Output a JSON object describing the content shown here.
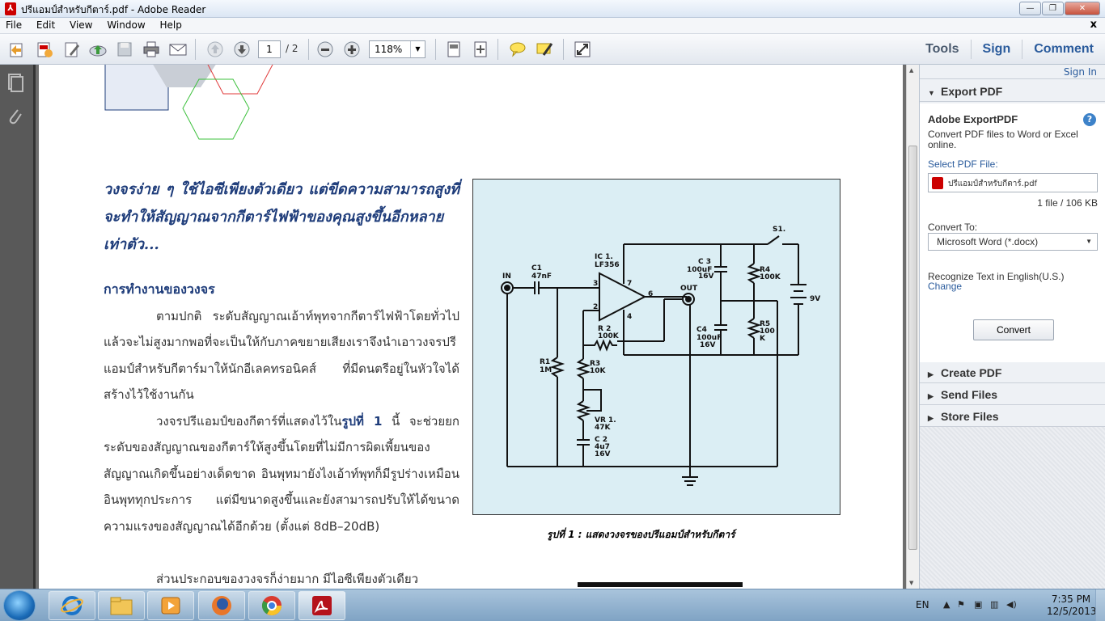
{
  "window": {
    "title": "ปรีแอมป์สำหรับกีตาร์.pdf - Adobe Reader",
    "minimize": "—",
    "maximize": "❐",
    "close": "✕"
  },
  "menu": {
    "items": [
      "File",
      "Edit",
      "View",
      "Window",
      "Help"
    ],
    "doc_close": "x"
  },
  "toolbar": {
    "page_current": "1",
    "page_total": "/ 2",
    "zoom": "118%",
    "tools_label": "Tools",
    "sign_label": "Sign",
    "comment_label": "Comment"
  },
  "document": {
    "headline": "วงจรง่าย ๆ ใช้ไอซีเพียงตัวเดียว แต่ขีดความสามารถสูงที่จะทำให้สัญญาณจากกีตาร์ไฟฟ้าของคุณสูงขึ้นอีกหลายเท่าตัว...",
    "section_title": "การทำงานของวงจร",
    "para1": "ตามปกติ ระดับสัญญาณเอ้าท์พุทจากกีตาร์ไฟฟ้าโดยทั่วไปแล้วจะไม่สูงมากพอที่จะเป็นให้กับภาคขยายเสียงเราจึงนำเอาวงจรปรีแอมป์สำหรับกีตาร์มาให้นักอีเลคทรอนิคส์ ที่มีดนตรีอยู่ในหัวใจได้สร้างไว้ใช้งานกัน",
    "para2_pre": "วงจรปรีแอมป์ของกีตาร์ที่แสดงไว้ใน",
    "para2_ref": "รูปที่ 1",
    "para2_post": " นี้ จะช่วยยกระดับของสัญญาณของกีตาร์ให้สูงขึ้นโดยที่ไม่มีการผิดเพี้ยนของสัญญาณเกิดขึ้นอย่างเด็ดขาด อินพุทมายังไงเอ้าท์พุทก็มีรูปร่างเหมือนอินพุททุกประการ แต่มีขนาดสูงขึ้นและยังสามารถปรับให้ได้ขนาดความแรงของสัญญาณได้อีกด้วย (ตั้งแต่ 8dB–20dB)",
    "para3": "ส่วนประกอบของวงจรก็ง่ายมาก มีไอซีเพียงตัวเดียว",
    "caption": "รูปที่ 1 : แสดงวงจรของปรีแอมป์สำหรับกีตาร์",
    "schematic_labels": {
      "in": "IN",
      "out": "OUT",
      "c1": "C1",
      "c1v": "47nF",
      "ic1": "IC 1.",
      "ic1v": "LF356",
      "pin3": "3",
      "pin2": "2",
      "pin7": "7",
      "pin6": "6",
      "pin4": "4",
      "c3": "C 3",
      "c3v": "100uF",
      "c3w": "16V",
      "r4": "R4",
      "r4v": "100K",
      "s1": "S1.",
      "bat": "9V",
      "r2": "R 2",
      "r2v": "100K",
      "c4": "C4",
      "c4v": "100uF",
      "c4w": "16V",
      "r5": "R5",
      "r5v": "100",
      "r5w": "K",
      "r1": "R1",
      "r1v": "1M",
      "r3": "R3",
      "r3v": "10K",
      "vr1": "VR 1.",
      "vr1v": "47K",
      "c2": "C 2",
      "c2v": "4u7",
      "c2w": "16V"
    }
  },
  "right_panel": {
    "sign_in": "Sign In",
    "export_pdf": "Export PDF",
    "adobe_exportpdf": "Adobe ExportPDF",
    "help": "?",
    "description": "Convert PDF files to Word or Excel online.",
    "select_label": "Select PDF File:",
    "file_name": "ปรีแอมป์สำหรับกีตาร์.pdf",
    "file_info": "1 file / 106 KB",
    "convert_to_label": "Convert To:",
    "convert_to_value": "Microsoft Word (*.docx)",
    "recognize": "Recognize Text in English(U.S.)",
    "change": "Change",
    "convert_button": "Convert",
    "create_pdf": "Create PDF",
    "send_files": "Send Files",
    "store_files": "Store Files"
  },
  "taskbar": {
    "lang": "EN",
    "time": "7:35 PM",
    "date": "12/5/2013"
  },
  "colors": {
    "heading_blue": "#1e3c7a",
    "schematic_bg": "#dbeef4",
    "link_blue": "#2a5b9c"
  }
}
